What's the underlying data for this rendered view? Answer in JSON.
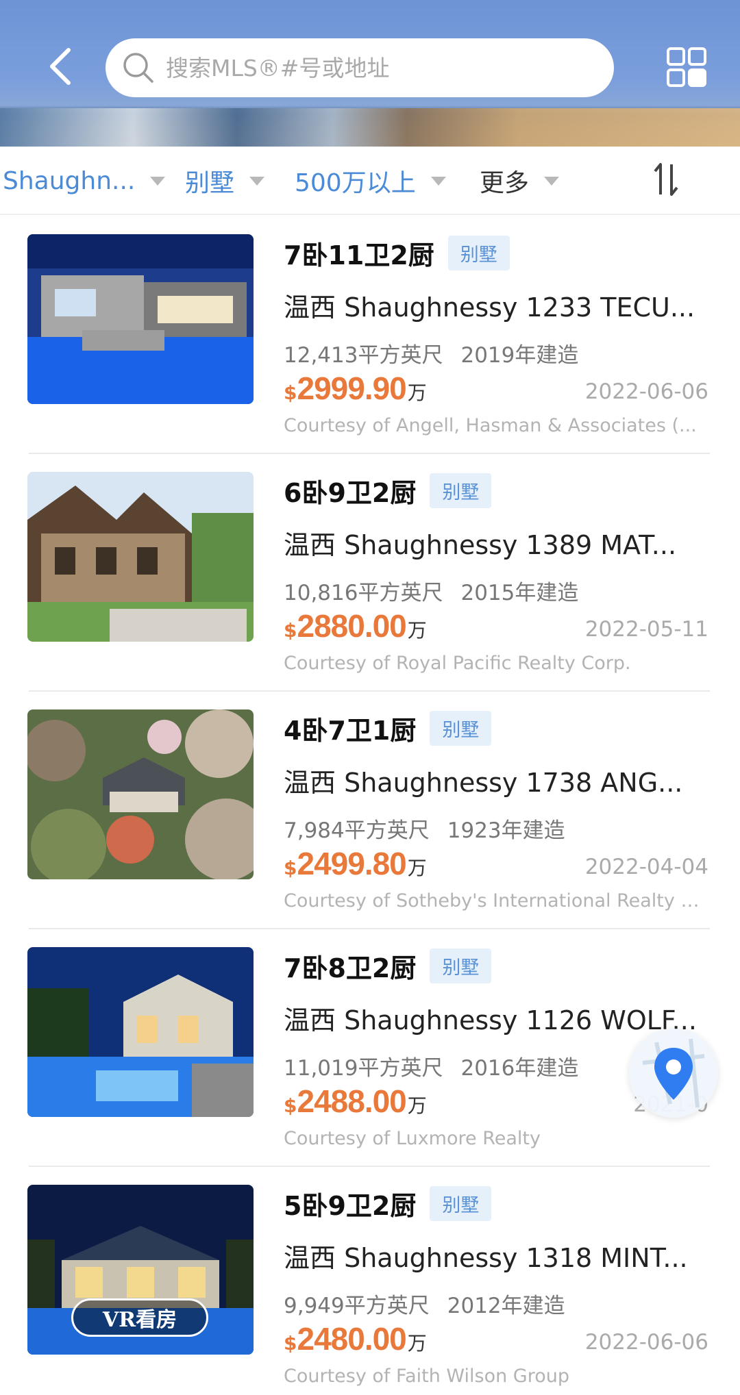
{
  "search": {
    "placeholder": "搜索MLS®#号或地址"
  },
  "filters": [
    {
      "label": "Shaughn..."
    },
    {
      "label": "别墅"
    },
    {
      "label": "500万以上"
    },
    {
      "label": "更多"
    }
  ],
  "colors": {
    "accent_blue": "#4a8ad6",
    "price_orange": "#e8793a",
    "tag_bg": "#e6f0fb"
  },
  "listings": [
    {
      "rooms": "7卧11卫2厨",
      "tag": "别墅",
      "title": "温西 Shaughnessy  1233 TECU...",
      "area": "12,413平方英尺",
      "built": "2019年建造",
      "currency": "$",
      "price": "2999.90",
      "unit": "万",
      "date": "2022-06-06",
      "courtesy": "Courtesy of Angell, Hasman & Associates (..."
    },
    {
      "rooms": "6卧9卫2厨",
      "tag": "别墅",
      "title": "温西 Shaughnessy  1389 MAT...",
      "area": "10,816平方英尺",
      "built": "2015年建造",
      "currency": "$",
      "price": "2880.00",
      "unit": "万",
      "date": "2022-05-11",
      "courtesy": "Courtesy of Royal Pacific Realty Corp."
    },
    {
      "rooms": "4卧7卫1厨",
      "tag": "别墅",
      "title": "温西 Shaughnessy  1738 ANG...",
      "area": "7,984平方英尺",
      "built": "1923年建造",
      "currency": "$",
      "price": "2499.80",
      "unit": "万",
      "date": "2022-04-04",
      "courtesy": "Courtesy of Sotheby's International Realty C..."
    },
    {
      "rooms": "7卧8卫2厨",
      "tag": "别墅",
      "title": "温西 Shaughnessy  1126 WOLF...",
      "area": "11,019平方英尺",
      "built": "2016年建造",
      "currency": "$",
      "price": "2488.00",
      "unit": "万",
      "date": "2021-0",
      "courtesy": "Courtesy of Luxmore Realty"
    },
    {
      "rooms": "5卧9卫2厨",
      "tag": "别墅",
      "title": "温西 Shaughnessy  1318 MINT...",
      "area": "9,949平方英尺",
      "built": "2012年建造",
      "currency": "$",
      "price": "2480.00",
      "unit": "万",
      "date": "2022-06-06",
      "courtesy": "Courtesy of Faith Wilson Group",
      "vr_label": "VR看房"
    }
  ]
}
